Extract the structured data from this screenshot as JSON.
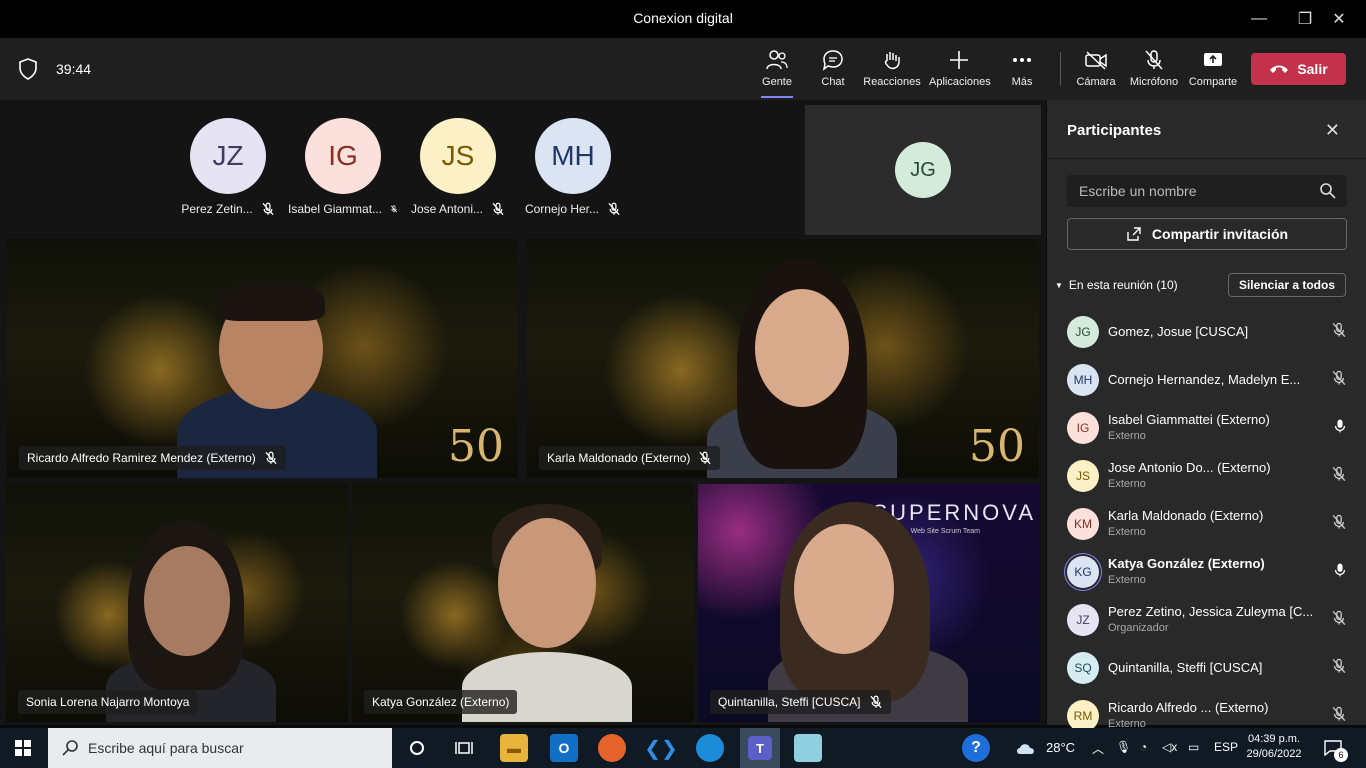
{
  "window": {
    "title": "Conexion digital",
    "min": "—",
    "max": "❐",
    "close": "✕"
  },
  "toolbar": {
    "timer": "39:44",
    "buttons": [
      {
        "label": "Gente"
      },
      {
        "label": "Chat"
      },
      {
        "label": "Reacciones"
      },
      {
        "label": "Aplicaciones"
      },
      {
        "label": "Más"
      },
      {
        "label": "Cámara"
      },
      {
        "label": "Micrófono"
      },
      {
        "label": "Comparte"
      }
    ],
    "leave_label": "Salir"
  },
  "top_avatars": [
    {
      "initials": "JZ",
      "name": "Perez Zetin...",
      "bg": "#e6e4f3",
      "fg": "#3e3c63"
    },
    {
      "initials": "IG",
      "name": "Isabel Giammat...",
      "bg": "#fbe0dc",
      "fg": "#8a2e24"
    },
    {
      "initials": "JS",
      "name": "Jose Antoni...",
      "bg": "#fbf0c6",
      "fg": "#7a5a00"
    },
    {
      "initials": "MH",
      "name": "Cornejo Her...",
      "bg": "#dbe4f2",
      "fg": "#1f3763"
    }
  ],
  "spotlight": {
    "initials": "JG"
  },
  "tiles": [
    {
      "name": "Ricardo Alfredo Ramirez Mendez (Externo)",
      "logo": "50"
    },
    {
      "name": "Karla Maldonado (Externo)",
      "logo": "50"
    },
    {
      "name": "Sonia Lorena Najarro Montoya"
    },
    {
      "name": "Katya González (Externo)"
    },
    {
      "name": "Quintanilla, Steffi [CUSCA]",
      "brand": "SUPERNOVA",
      "brand_sub": "Web Site Scrum Team"
    }
  ],
  "panel": {
    "title": "Participantes",
    "search_placeholder": "Escribe un nombre",
    "invite_label": "Compartir invitación",
    "section_label": "En esta reunión (10)",
    "mute_all_label": "Silenciar a todos",
    "participants": [
      {
        "initials": "JG",
        "name": "Gomez, Josue [CUSCA]",
        "role": "",
        "bg": "#d4ebdc",
        "fg": "#244a34",
        "mic": "muted"
      },
      {
        "initials": "MH",
        "name": "Cornejo Hernandez, Madelyn E...",
        "role": "",
        "bg": "#dbe4f2",
        "fg": "#1f3763",
        "mic": "muted"
      },
      {
        "initials": "IG",
        "name": "Isabel Giammattei (Externo)",
        "role": "Externo",
        "bg": "#fbe0dc",
        "fg": "#8a2e24",
        "mic": "on"
      },
      {
        "initials": "JS",
        "name": "Jose Antonio Do...  (Externo)",
        "role": "Externo",
        "bg": "#fbf0c6",
        "fg": "#7a5a00",
        "mic": "muted"
      },
      {
        "initials": "KM",
        "name": "Karla Maldonado (Externo)",
        "role": "Externo",
        "bg": "#fbe0dc",
        "fg": "#8a2e24",
        "mic": "muted"
      },
      {
        "initials": "KG",
        "name": "Katya González (Externo)",
        "role": "Externo",
        "bg": "#dbe4f2",
        "fg": "#1f3763",
        "mic": "on"
      },
      {
        "initials": "JZ",
        "name": "Perez Zetino, Jessica Zuleyma [C...",
        "role": "Organizador",
        "bg": "#e6e4f3",
        "fg": "#3e3c63",
        "mic": "muted"
      },
      {
        "initials": "SQ",
        "name": "Quintanilla, Steffi [CUSCA]",
        "role": "",
        "bg": "#d6ecf1",
        "fg": "#1d4d5a",
        "mic": "muted"
      },
      {
        "initials": "RM",
        "name": "Ricardo Alfredo ...  (Externo)",
        "role": "Externo",
        "bg": "#fbf0c6",
        "fg": "#7a5a00",
        "mic": "muted"
      }
    ]
  },
  "taskbar": {
    "search_placeholder": "Escribe aquí para buscar",
    "weather": "28°C",
    "lang": "ESP",
    "time": "04:39 p.m.",
    "date": "29/06/2022",
    "notifications": "6"
  }
}
